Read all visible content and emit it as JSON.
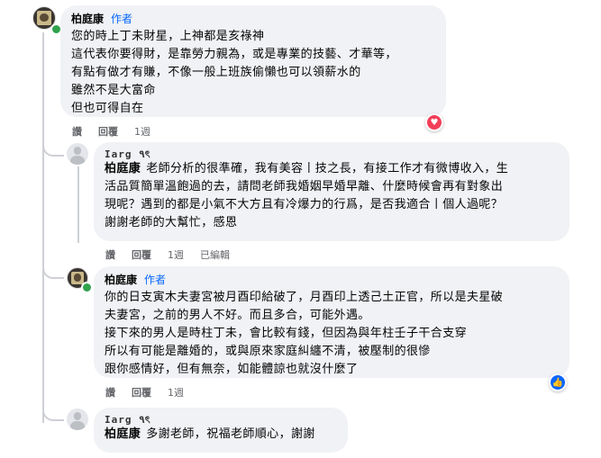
{
  "comments": [
    {
      "author": "柏庭康",
      "author_tag": "作者",
      "lines": [
        "您的時上丁未財星，上神都是亥祿神",
        "這代表你要得財，是靠勞力親為，或是專業的技藝、才華等，",
        "有點有做才有賺，不像一般上班族偷懶也可以領薪水的",
        "雖然不是大富命",
        "但也可得自在"
      ],
      "actions": [
        "讚",
        "回覆",
        "1週"
      ],
      "reaction": "heart-reaction"
    },
    {
      "author": "Ιarg ٩ৎ",
      "mention": "柏庭康",
      "lines_first": "老師分析的很準確，我有美容丨技之長，有接工作才有微博收入，生",
      "lines": [
        "活品質簡單溫飽過的去，請問老師我婚姻早婚早離、什麼時候會再有對象出",
        "現呢？遇到的都是小氣不大方且有冷爆力的行爲，是否我適合丨個人過呢？",
        "謝謝老師的大幫忙，感恩"
      ],
      "actions": [
        "讚",
        "回覆",
        "1週",
        "已編輯"
      ]
    },
    {
      "author": "柏庭康",
      "author_tag": "作者",
      "lines": [
        "你的日支寅木夫妻宮被月酉印給破了，月酉印上透己土正官，所以是夫星破",
        "夫妻宮，之前的男人不好。而且多合，可能外遇。",
        "接下來的男人是時柱丁未，會比較有錢，但因為與年柱壬子干合支穿",
        "所以有可能是離婚的，或與原來家庭糾纏不清，被壓制的很慘",
        "跟你感情好，但有無奈，如能體諒也就沒什麼了"
      ],
      "actions": [
        "讚",
        "回覆",
        "1週"
      ],
      "reaction": "like-reaction"
    },
    {
      "author": "Ιarg ٩ৎ",
      "mention": "柏庭康",
      "lines_first": "多謝老師，祝福老師順心，謝謝",
      "lines": []
    }
  ],
  "colors": {
    "bubble": "#f0f2f5",
    "author_tag": "#0866ff",
    "meta": "#65676b",
    "heart": "#f33e58",
    "like": "#0866ff",
    "online": "#31a24c"
  }
}
